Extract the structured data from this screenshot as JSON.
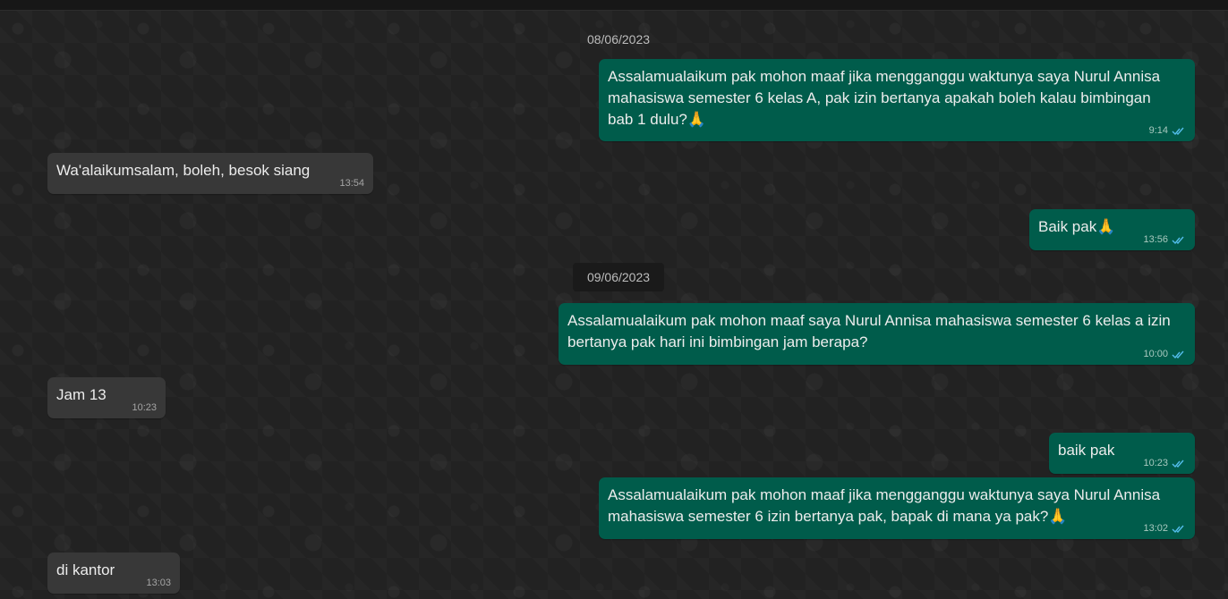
{
  "dates": [
    {
      "label": "08/06/2023"
    },
    {
      "label": "09/06/2023"
    }
  ],
  "messages": [
    {
      "direction": "out",
      "text": "Assalamualaikum pak mohon maaf jika mengganggu waktunya saya Nurul Annisa mahasiswa semester 6 kelas A, pak izin bertanya apakah boleh kalau bimbingan bab 1 dulu?🙏",
      "time": "9:14",
      "status": "read-double-check-icon"
    },
    {
      "direction": "in",
      "text": "Wa'alaikumsalam, boleh, besok siang",
      "time": "13:54"
    },
    {
      "direction": "out",
      "text": "Baik pak🙏",
      "time": "13:56",
      "status": "read-double-check-icon"
    },
    {
      "direction": "out",
      "text": "Assalamualaikum pak mohon maaf saya Nurul Annisa mahasiswa semester 6 kelas a izin bertanya pak hari ini bimbingan jam berapa?",
      "time": "10:00",
      "status": "read-double-check-icon"
    },
    {
      "direction": "in",
      "text": "Jam 13",
      "time": "10:23"
    },
    {
      "direction": "out",
      "text": "baik pak",
      "time": "10:23",
      "status": "read-double-check-icon"
    },
    {
      "direction": "out",
      "text": "Assalamualaikum pak mohon maaf jika mengganggu waktunya saya Nurul Annisa mahasiswa semester 6 izin bertanya pak, bapak di mana ya pak?🙏",
      "time": "13:02",
      "status": "read-double-check-icon"
    },
    {
      "direction": "in",
      "text": "di kantor",
      "time": "13:03"
    }
  ],
  "colors": {
    "outgoing_bubble": "#005c4b",
    "incoming_bubble": "#383838",
    "read_check": "#53bdeb",
    "background": "#222222"
  }
}
